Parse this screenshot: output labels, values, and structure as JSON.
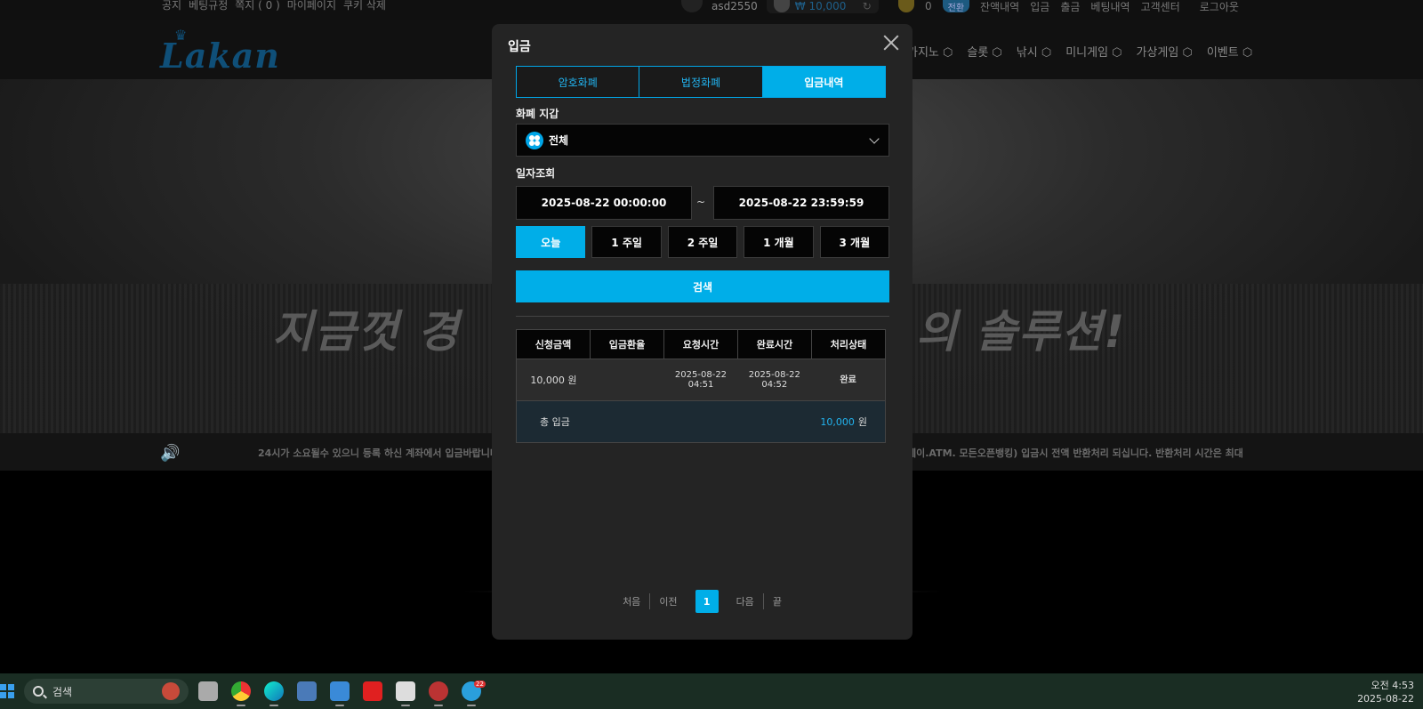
{
  "topbar": {
    "links": [
      "공지",
      "베팅규정",
      "쪽지 ( 0 )",
      "마이페이지",
      "쿠키 삭제"
    ],
    "username": "asd2550",
    "balance": "₩ 10,000",
    "points": "0",
    "convert_label": "전환",
    "right_links": [
      "잔액내역",
      "입금",
      "출금",
      "베팅내역",
      "고객센터",
      "로그아웃"
    ]
  },
  "header": {
    "logo": "Lakan",
    "nav": [
      "카지노",
      "슬롯",
      "낚시",
      "미니게임",
      "가상게임",
      "이벤트"
    ]
  },
  "banner": {
    "text_left": "지금껏 경",
    "text_right": "의 솔루션!"
  },
  "notice": {
    "text_left": "24시가 소요될수 있으니 등록 하신 계좌에서 입금바랍니다",
    "text_right": "페이.ATM. 모든오픈뱅킹) 입금시 전액 반환처리 되십니다. 반환처리 시간은 최대"
  },
  "modal": {
    "title": "입금",
    "tabs": [
      {
        "label": "암호화폐",
        "active": false
      },
      {
        "label": "법정화폐",
        "active": false
      },
      {
        "label": "입금내역",
        "active": true
      }
    ],
    "wallet_label": "화폐 지갑",
    "wallet_value": "전체",
    "date_label": "일자조회",
    "date_from": "2025-08-22 00:00:00",
    "date_sep": "~",
    "date_to": "2025-08-22 23:59:59",
    "periods": [
      "오늘",
      "1 주일",
      "2 주일",
      "1 개월",
      "3 개월"
    ],
    "active_period": 0,
    "search_label": "검색",
    "table": {
      "headers": [
        "신청금액",
        "입금환율",
        "요청시간",
        "완료시간",
        "처리상태"
      ],
      "rows": [
        {
          "amount": "10,000 원",
          "rate": "",
          "requested_date": "2025-08-22",
          "requested_time": "04:51",
          "completed_date": "2025-08-22",
          "completed_time": "04:52",
          "status": "완료"
        }
      ],
      "total_label": "총 입금",
      "total_value": "10,000",
      "total_unit": "원"
    },
    "pager": {
      "first": "처음",
      "prev": "이전",
      "current": "1",
      "next": "다음",
      "last": "끝"
    }
  },
  "taskbar": {
    "search_placeholder": "검색",
    "badge_count": "22",
    "time": "오전 4:53",
    "date": "2025-08-22"
  },
  "colors": {
    "accent": "#00aee8",
    "success": "#4ccd3a",
    "modal_bg": "#242424"
  }
}
